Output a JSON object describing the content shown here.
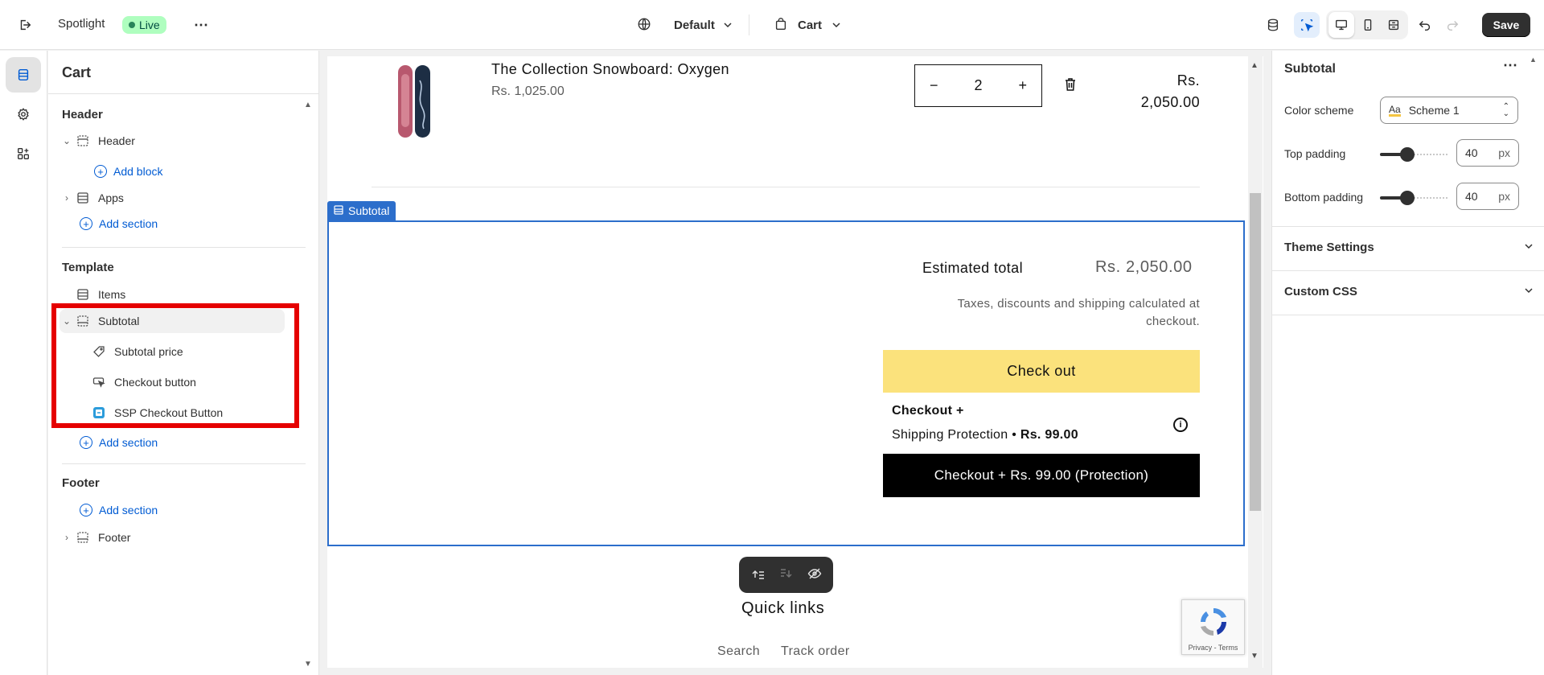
{
  "topbar": {
    "app_name": "Spotlight",
    "status": "Live",
    "theme_selector": "Default",
    "page_selector": "Cart",
    "save_label": "Save"
  },
  "left_panel": {
    "title": "Cart",
    "sections": {
      "header": {
        "label": "Header",
        "items": [
          "Header",
          "Add block",
          "Apps",
          "Add section"
        ]
      },
      "template": {
        "label": "Template",
        "items": [
          "Items",
          "Subtotal"
        ],
        "subtotal_blocks": [
          "Subtotal price",
          "Checkout button",
          "SSP Checkout Button"
        ],
        "add_section": "Add section"
      },
      "footer": {
        "label": "Footer",
        "add_section": "Add section",
        "items": [
          "Footer"
        ]
      }
    }
  },
  "preview": {
    "product": {
      "name": "The Collection Snowboard: Oxygen",
      "price": "Rs. 1,025.00",
      "quantity": "2",
      "qty_minus": "−",
      "qty_plus": "+",
      "line_total_currency": "Rs.",
      "line_total_amount": "2,050.00"
    },
    "subtotal_tag": "Subtotal",
    "estimated_total_label": "Estimated total",
    "estimated_total_value": "Rs. 2,050.00",
    "tax_note_line1": "Taxes, discounts and shipping calculated at",
    "tax_note_line2": "checkout.",
    "checkout_label": "Check out",
    "protection_title": "Checkout +",
    "protection_sub": "Shipping Protection •",
    "protection_price": "Rs. 99.00",
    "protection_button": "Checkout + Rs. 99.00 (Protection)",
    "quick_links_title": "Quick links",
    "quick_links": [
      "Search",
      "Track order"
    ],
    "recaptcha_text": "Privacy - Terms"
  },
  "right_panel": {
    "title": "Subtotal",
    "color_scheme_label": "Color scheme",
    "color_scheme_value": "Scheme 1",
    "top_padding_label": "Top padding",
    "top_padding_value": "40",
    "bottom_padding_label": "Bottom padding",
    "bottom_padding_value": "40",
    "padding_unit": "px",
    "padding_fraction": 0.4,
    "accordions": [
      "Theme Settings",
      "Custom CSS"
    ]
  },
  "colors": {
    "accent_blue": "#2c6ecb",
    "highlight_red": "#e50000",
    "checkout_yellow": "#fbe27c"
  }
}
